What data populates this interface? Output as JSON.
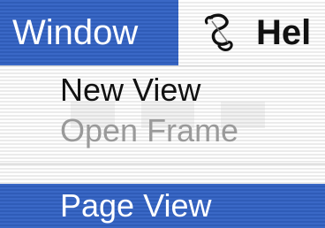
{
  "menubar": {
    "active_menu": "Window",
    "next_menu_partial": "Hel",
    "script_menu_icon": "script-scroll-icon"
  },
  "window_menu": {
    "items": [
      {
        "label": "New View",
        "enabled": true,
        "highlighted": false
      },
      {
        "label": "Open Frame",
        "enabled": false,
        "highlighted": false
      },
      {
        "label": "Page View",
        "enabled": true,
        "highlighted": true
      }
    ]
  },
  "colors": {
    "highlight": "#3a68c6",
    "text": "#111111",
    "disabled_text": "#9a9a9a",
    "highlight_text": "#ffffff"
  }
}
